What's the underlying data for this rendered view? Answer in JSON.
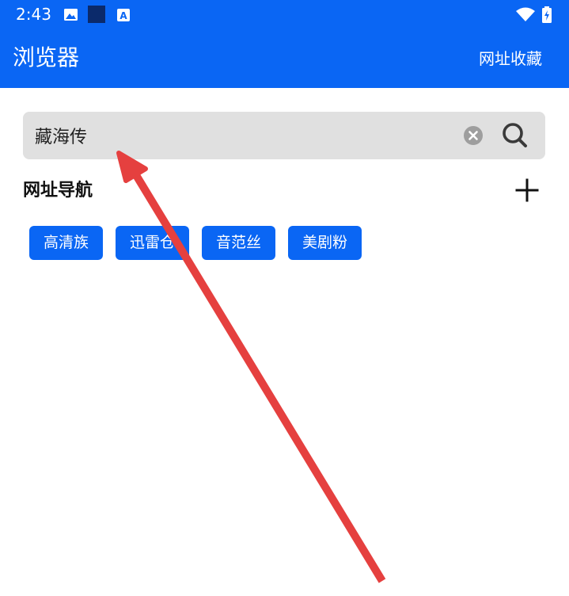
{
  "status_bar": {
    "time": "2:43",
    "icons": [
      "image-icon",
      "app-square-icon",
      "font-a-icon",
      "wifi-icon",
      "battery-charging-icon"
    ]
  },
  "app_bar": {
    "title": "浏览器",
    "bookmark_label": "网址收藏"
  },
  "search": {
    "value": "藏海传",
    "placeholder": ""
  },
  "nav": {
    "title": "网址导航",
    "chips": [
      {
        "label": "高清族"
      },
      {
        "label": "迅雷仓"
      },
      {
        "label": "音范丝"
      },
      {
        "label": "美剧粉"
      }
    ]
  },
  "colors": {
    "primary": "#0a66f4",
    "search_bg": "#e0e0e0",
    "annotation": "#e5403f"
  }
}
